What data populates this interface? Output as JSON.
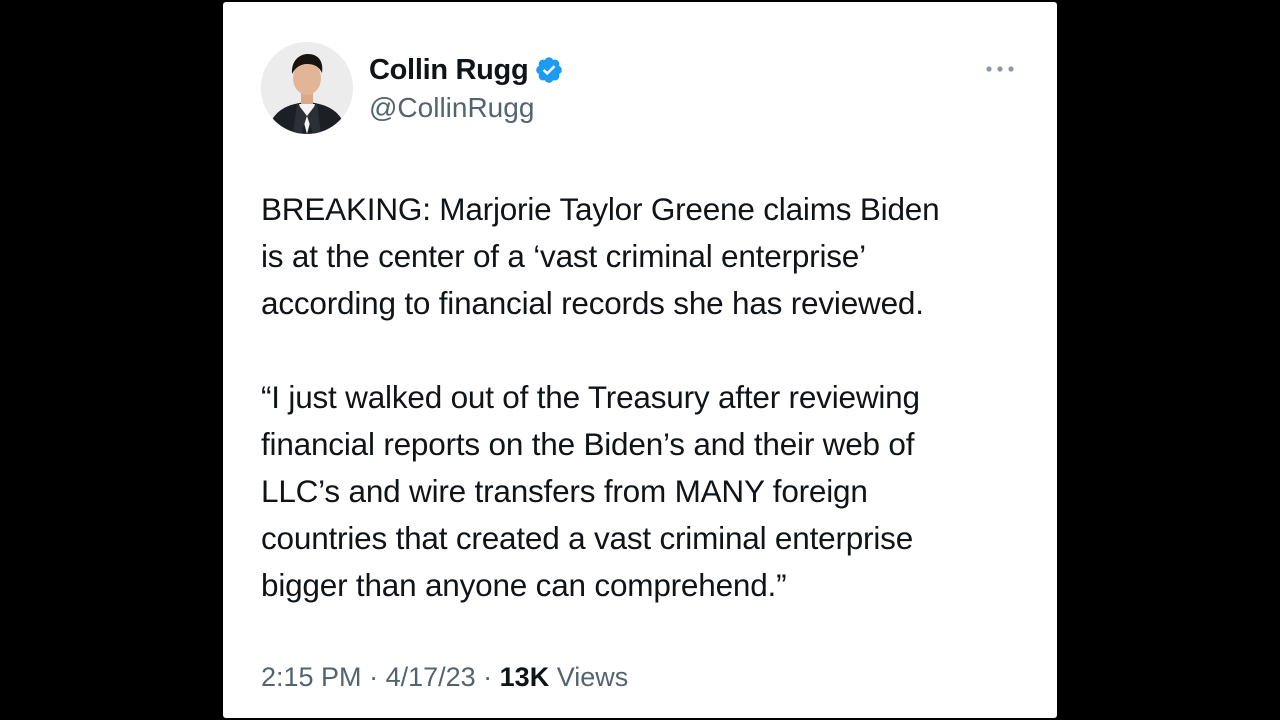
{
  "author": {
    "display_name": "Collin Rugg",
    "handle": "@CollinRugg",
    "verified_icon": "verified-badge-icon",
    "avatar_icon": "profile-photo"
  },
  "menu": {
    "icon": "more-horizontal-icon",
    "label": "···"
  },
  "tweet": {
    "paragraph_1": "BREAKING: Marjorie Taylor Greene claims Biden\nis at the center of a ‘vast criminal enterprise’\naccording to financial records she has reviewed.",
    "paragraph_2": "“I just walked out of the Treasury after reviewing\nfinancial reports on the Biden’s and their web of\nLLC’s and wire transfers from MANY foreign\ncountries that created a vast criminal enterprise\nbigger than anyone can comprehend.”"
  },
  "meta": {
    "time": "2:15 PM",
    "separator": " · ",
    "date": "4/17/23",
    "views_count": "13K",
    "views_label": " Views"
  },
  "colors": {
    "background": "#000000",
    "card": "#ffffff",
    "text_primary": "#0f1419",
    "text_secondary": "#536471",
    "verified_blue": "#1d9bf0"
  }
}
